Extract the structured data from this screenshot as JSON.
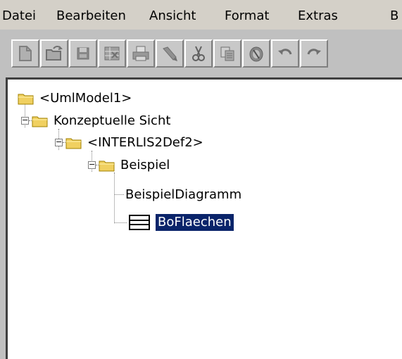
{
  "menu": {
    "items": [
      "Datei",
      "Bearbeiten",
      "Ansicht",
      "Format",
      "Extras",
      "B"
    ]
  },
  "toolbar": {
    "buttons": [
      {
        "icon": "new-document-icon"
      },
      {
        "icon": "open-folder-icon"
      },
      {
        "icon": "save-disk-icon"
      },
      {
        "icon": "spreadsheet-icon"
      },
      {
        "icon": "print-icon"
      },
      {
        "icon": "brush-icon"
      },
      {
        "icon": "cut-scissors-icon"
      },
      {
        "icon": "copy-icon"
      },
      {
        "icon": "paste-icon"
      },
      {
        "icon": "undo-icon"
      },
      {
        "icon": "redo-icon"
      }
    ]
  },
  "tree": {
    "root": "<UmlModel1>",
    "n1": "Konzeptuelle Sicht",
    "n2": "<INTERLIS2Def2>",
    "n3": "Beispiel",
    "n4": "BeispielDiagramm",
    "n5": "BoFlaechen"
  },
  "colors": {
    "selection": "#0a246a",
    "folder": "#f0d060",
    "background": "#c0c0c0"
  }
}
